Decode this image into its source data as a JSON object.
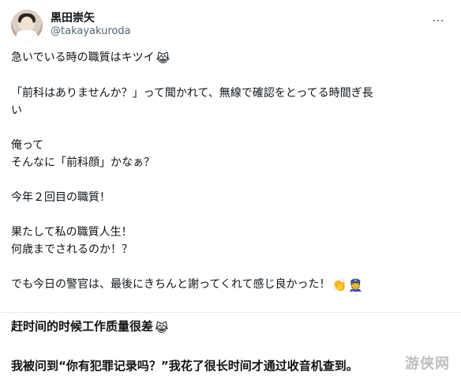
{
  "header": {
    "name": "黒田崇矢",
    "handle": "@takayakuroda",
    "more_icon": "⋯"
  },
  "tweet": {
    "line1": "急いでいる時の職質はキツイ",
    "line1_emoji": "😹",
    "line2": "「前科はありませんか？」って聞かれて、無線で確認をとってる時間ぎ長",
    "line3": "い",
    "line4": "俺って",
    "line5": "そんなに「前科顔」かなぁ？",
    "line6": "今年２回目の職質！",
    "line7": "果たして私の職質人生！",
    "line8": "何歳までされるのか！？",
    "line9": "でも今日の警官は、最後にきちんと謝ってくれて感じ良かった！",
    "line9_emoji1": "👏",
    "line9_emoji2": "👮"
  },
  "translation": {
    "line1": "赶时间的时候工作质量很差",
    "line1_emoji": "😹",
    "line2": "我被问到“你有犯罪记录吗？”我花了很长时间才通过收音机查到。"
  },
  "watermark": "游侠网"
}
